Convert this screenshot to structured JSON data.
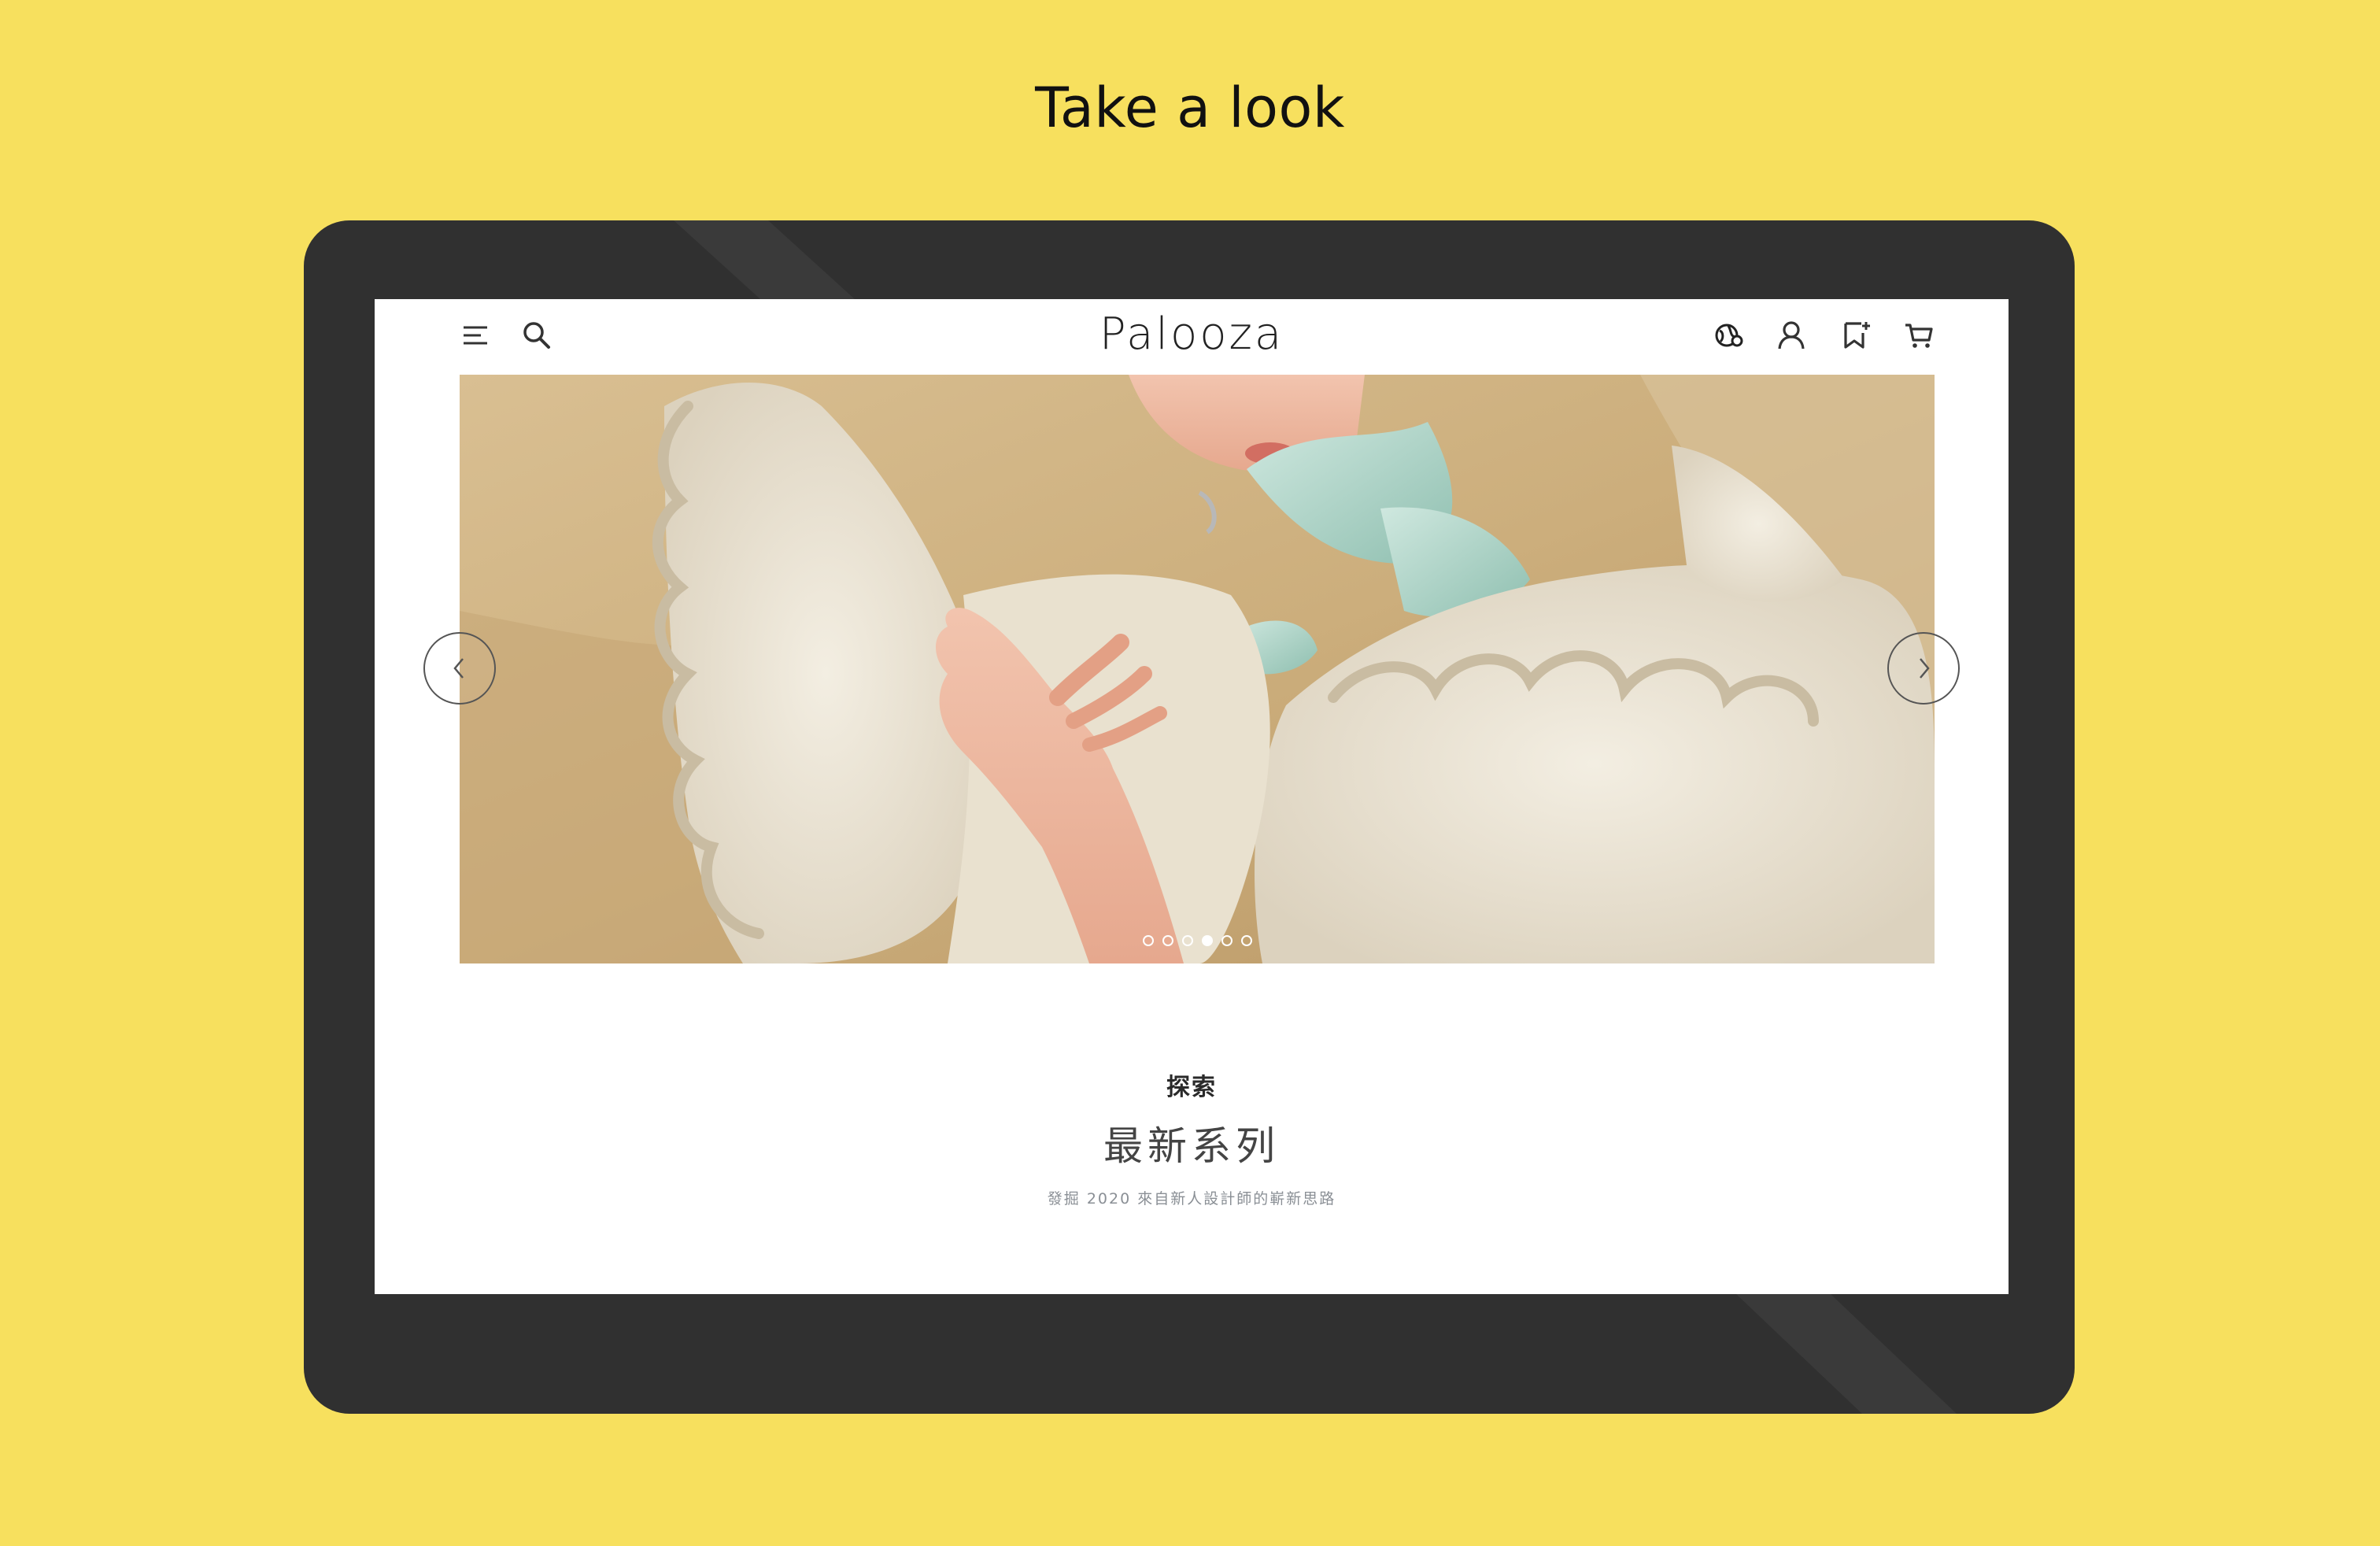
{
  "showcase": {
    "heading": "Take a look",
    "background_color": "#F7E05E",
    "device_color": "#303030"
  },
  "header": {
    "logo": "Palooza",
    "icons": {
      "menu": "menu-icon",
      "search": "search-icon",
      "language": "globe-icon",
      "account": "user-icon",
      "wishlist": "bookmark-icon",
      "cart": "cart-icon"
    }
  },
  "hero": {
    "slide_count": 6,
    "active_slide": 4,
    "prev_icon": "chevron-left-icon",
    "next_icon": "chevron-right-icon"
  },
  "explore": {
    "kicker": "探索",
    "title": "最新系列",
    "subtitle": "發掘 2020 來自新人設計師的嶄新思路"
  }
}
